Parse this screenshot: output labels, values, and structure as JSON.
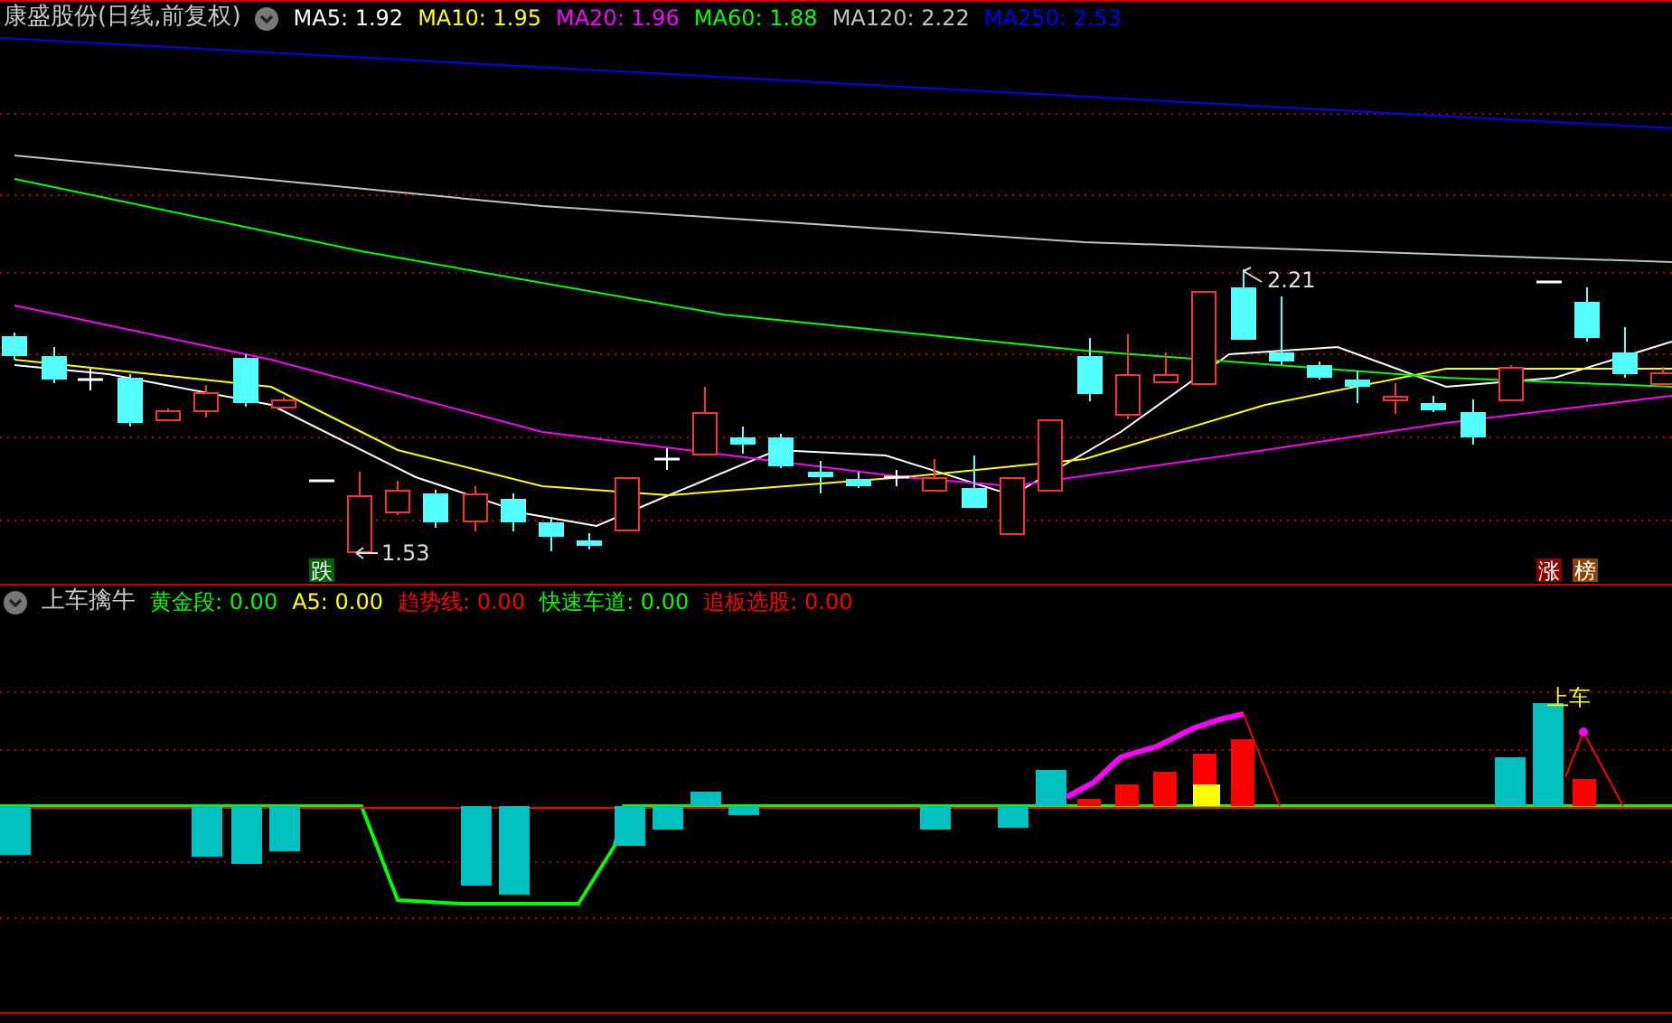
{
  "main_panel": {
    "title": "康盛股份(日线,前复权)",
    "indicators": [
      {
        "label": "MA5: 1.92",
        "color": "#ffffff"
      },
      {
        "label": "MA10: 1.95",
        "color": "#ffff00"
      },
      {
        "label": "MA20: 1.96",
        "color": "#ff00ff"
      },
      {
        "label": "MA60: 1.88",
        "color": "#00ff00"
      },
      {
        "label": "MA120: 2.22",
        "color": "#c0c0c0"
      },
      {
        "label": "MA250: 2.53",
        "color": "#0000ff"
      }
    ],
    "high_label": "2.21",
    "low_label": "1.53",
    "badges": [
      {
        "text": "跌",
        "color": "#006400"
      },
      {
        "text": "涨",
        "color": "#8b0000"
      },
      {
        "text": "榜",
        "color": "#8b4500"
      }
    ]
  },
  "sub_panel": {
    "title": "上车擒牛",
    "indicators": [
      {
        "label": "黄金段: 0.00",
        "color": "#00ff00"
      },
      {
        "label": "A5: 0.00",
        "color": "#ffff00"
      },
      {
        "label": "趋势线: 0.00",
        "color": "#ff0000"
      },
      {
        "label": "快速车道: 0.00",
        "color": "#00ff00"
      },
      {
        "label": "追板选股: 0.00",
        "color": "#ff0000"
      }
    ],
    "signal_label": "上车"
  }
}
